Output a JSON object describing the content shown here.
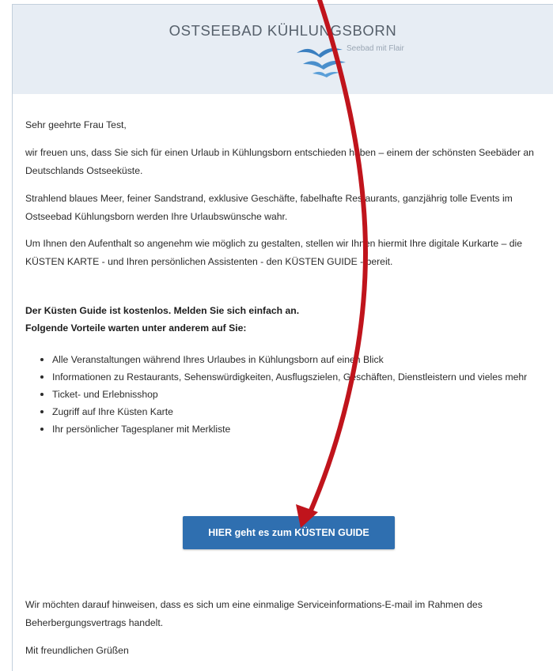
{
  "header": {
    "brand_title": "OSTSEEBAD KÜHLUNGSBORN",
    "tagline": "Seebad mit Flair"
  },
  "email": {
    "greeting": "Sehr geehrte Frau Test,",
    "intro": "wir freuen uns, dass Sie sich für einen Urlaub in Kühlungsborn entschieden haben – einem der schönsten Seebäder an Deutschlands Ostseeküste.",
    "highlights": "Strahlend blaues Meer, feiner Sandstrand, exklusive Geschäfte, fabelhafte Restaurants, ganzjährig tolle Events im Ostseebad Kühlungsborn werden Ihre Urlaubswünsche wahr.",
    "offer": "Um Ihnen den Aufenthalt so angenehm wie möglich zu gestalten, stellen wir Ihnen hiermit Ihre digitale Kurkarte – die KÜSTEN KARTE - und Ihren persönlichen Assistenten - den KÜSTEN GUIDE - bereit.",
    "guide_free": "Der Küsten Guide ist kostenlos. Melden Sie sich einfach an.",
    "benefits_intro": "Folgende Vorteile warten unter anderem auf Sie:",
    "benefits": [
      "Alle Veranstaltungen während Ihres Urlaubes in Kühlungsborn auf einen Blick",
      "Informationen zu Restaurants, Sehenswürdigkeiten, Ausflugszielen, Geschäften, Dienstleistern und vieles mehr",
      "Ticket- und Erlebnisshop",
      "Zugriff auf Ihre Küsten Karte",
      "Ihr persönlicher Tagesplaner mit Merkliste"
    ],
    "cta_label": "HIER geht es zum KÜSTEN GUIDE",
    "notice": "Wir möchten darauf hinweisen, dass es sich um eine einmalige Serviceinformations-E-mail im Rahmen des Beherbergungsvertrags handelt.",
    "closing": "Mit freundlichen Grüßen"
  },
  "colors": {
    "header_bg": "#e7edf4",
    "button_bg": "#2f6fb0",
    "arrow": "#c0141c"
  },
  "icons": {
    "logo": "seagull-logo-icon",
    "arrow": "annotation-arrow-icon"
  }
}
